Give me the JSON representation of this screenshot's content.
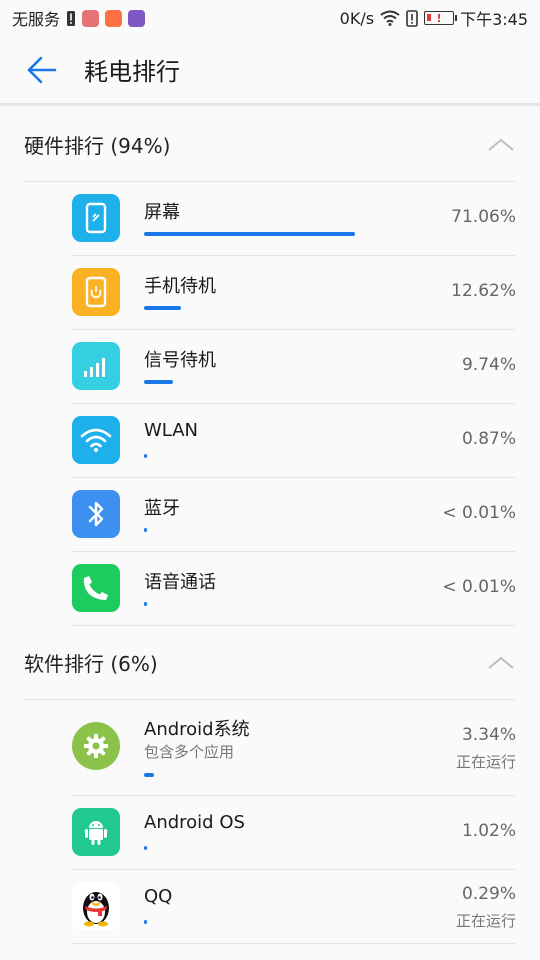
{
  "status_bar": {
    "carrier": "无服务",
    "net_speed": "0K/s",
    "time": "下午3:45"
  },
  "header": {
    "title": "耗电排行"
  },
  "hardware": {
    "title": "硬件排行 (94%)",
    "items": [
      {
        "name": "屏幕",
        "percent": "71.06%",
        "fraction": 0.7106,
        "icon": "screen-icon",
        "color": "#1eb0ea"
      },
      {
        "name": "手机待机",
        "percent": "12.62%",
        "fraction": 0.1262,
        "icon": "phone-standby-icon",
        "color": "#fbb124"
      },
      {
        "name": "信号待机",
        "percent": "9.74%",
        "fraction": 0.0974,
        "icon": "signal-icon",
        "color": "#34cfe0"
      },
      {
        "name": "WLAN",
        "percent": "0.87%",
        "fraction": 0.0087,
        "icon": "wifi-icon",
        "color": "#1eb0ea"
      },
      {
        "name": "蓝牙",
        "percent": "< 0.01%",
        "fraction": 0.0001,
        "icon": "bluetooth-icon",
        "color": "#3d8ff0"
      },
      {
        "name": "语音通话",
        "percent": "< 0.01%",
        "fraction": 0.0001,
        "icon": "phone-call-icon",
        "color": "#1ecb5e"
      }
    ]
  },
  "software": {
    "title": "软件排行 (6%)",
    "items": [
      {
        "name": "Android系统",
        "sub": "包含多个应用",
        "percent": "3.34%",
        "status": "正在运行",
        "fraction": 0.0334,
        "icon": "android-system-gear-icon",
        "color": "#8bc34a"
      },
      {
        "name": "Android OS",
        "sub": "",
        "percent": "1.02%",
        "status": "",
        "fraction": 0.0102,
        "icon": "android-robot-icon",
        "color": "#22c98e"
      },
      {
        "name": "QQ",
        "sub": "",
        "percent": "0.29%",
        "status": "正在运行",
        "fraction": 0.0029,
        "icon": "qq-penguin-icon",
        "color": "#ffffff"
      }
    ]
  }
}
